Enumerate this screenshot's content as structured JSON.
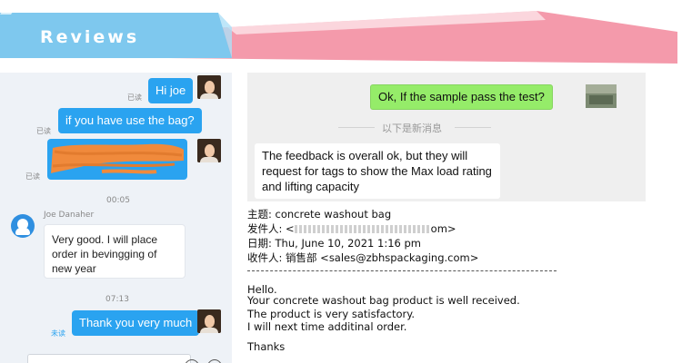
{
  "banner": {
    "title": "Reviews",
    "colors": {
      "blue": "#7ec8ee",
      "pink": "#f49aab"
    }
  },
  "left_chat": {
    "messages": [
      {
        "text": "Hi joe",
        "status": "已读"
      },
      {
        "text": "if you have use the bag?",
        "status": "已读"
      },
      {
        "text": "",
        "status": "已读",
        "redacted": true
      },
      {
        "time": "00:05"
      },
      {
        "sender": "Joe Danaher",
        "text": "Very good. I will place order in bevingging of new year"
      },
      {
        "time": "07:13"
      },
      {
        "text": "Thank you very much",
        "status": "未读"
      }
    ],
    "colors": {
      "bubble": "#2aa3f0",
      "background": "#eef2f7"
    }
  },
  "wechat": {
    "outgoing": "Ok, If the sample pass the test?",
    "divider": "以下是新消息",
    "incoming": "The feedback is overall ok, but they will request for tags to show the Max load rating and lifting capacity",
    "colors": {
      "green": "#95ec69"
    }
  },
  "email": {
    "subject": "主题: concrete washout bag",
    "from_prefix": "发件人: <",
    "from_suffix": "om>",
    "date": "日期: Thu, June 10, 2021 1:16 pm",
    "to": "收件人: 销售部 <sales@zbhspackaging.com>",
    "body": [
      "Hello.",
      "Your concrete washout  bag product is well received.",
      "The product  is very satisfactory.",
      " I will next time additinal order."
    ],
    "closing": "Thanks"
  }
}
